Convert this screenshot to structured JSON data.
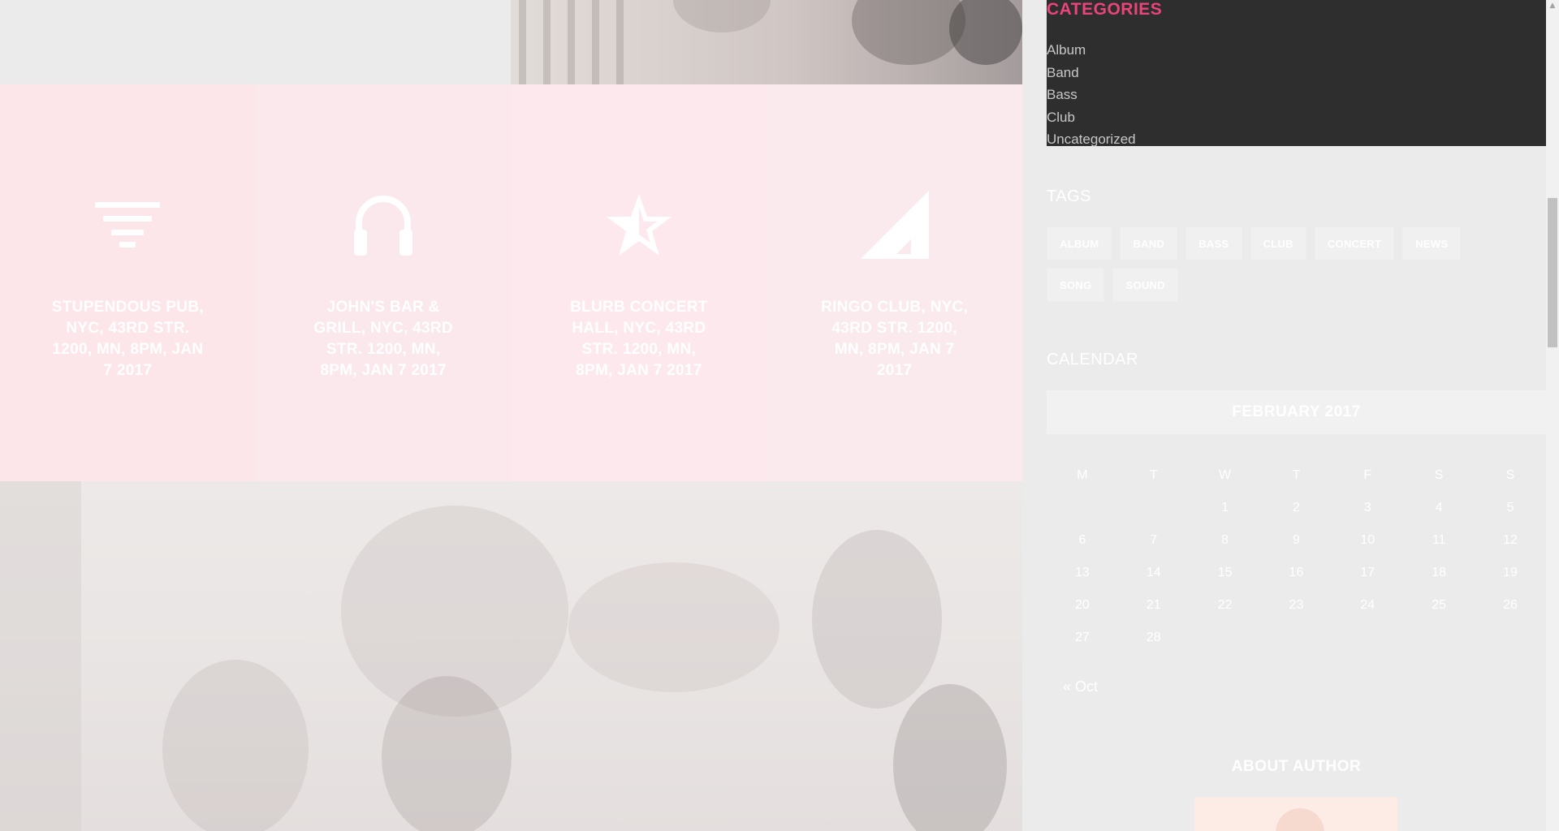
{
  "events": [
    {
      "icon": "filter-lines-icon",
      "text": "STUPENDOUS PUB, NYC, 43RD STR. 1200, MN, 8PM, JAN 7 2017"
    },
    {
      "icon": "headphones-icon",
      "text": "JOHN'S BAR & GRILL, NYC, 43RD STR. 1200, MN, 8PM, JAN 7 2017"
    },
    {
      "icon": "star-half-icon",
      "text": "BLURB CONCERT HALL, NYC, 43RD STR. 1200, MN, 8PM, JAN 7 2017"
    },
    {
      "icon": "signal-triangle-icon",
      "text": "RINGO CLUB, NYC, 43RD STR. 1200, MN, 8PM, JAN 7 2017"
    }
  ],
  "sidebar": {
    "categories": {
      "title": "CATEGORIES",
      "items": [
        "Album",
        "Band",
        "Bass",
        "Club",
        "Uncategorized"
      ]
    },
    "tags": {
      "title": "TAGS",
      "items": [
        "ALBUM",
        "BAND",
        "BASS",
        "CLUB",
        "CONCERT",
        "NEWS",
        "SONG",
        "SOUND"
      ]
    },
    "calendar": {
      "title": "CALENDAR",
      "month": "FEBRUARY 2017",
      "weekdays": [
        "M",
        "T",
        "W",
        "T",
        "F",
        "S",
        "S"
      ],
      "weeks": [
        [
          "",
          "",
          "1",
          "2",
          "3",
          "4",
          "5"
        ],
        [
          "6",
          "7",
          "8",
          "9",
          "10",
          "11",
          "12"
        ],
        [
          "13",
          "14",
          "15",
          "16",
          "17",
          "18",
          "19"
        ],
        [
          "20",
          "21",
          "22",
          "23",
          "24",
          "25",
          "26"
        ],
        [
          "27",
          "28",
          "",
          "",
          "",
          "",
          ""
        ]
      ],
      "prev_link": "« Oct"
    },
    "about": {
      "title": "ABOUT AUTHOR"
    }
  },
  "colors": {
    "accent": "#e8457a",
    "category_bg": "#2e2e2e",
    "event_bg": "#fde6e9"
  }
}
